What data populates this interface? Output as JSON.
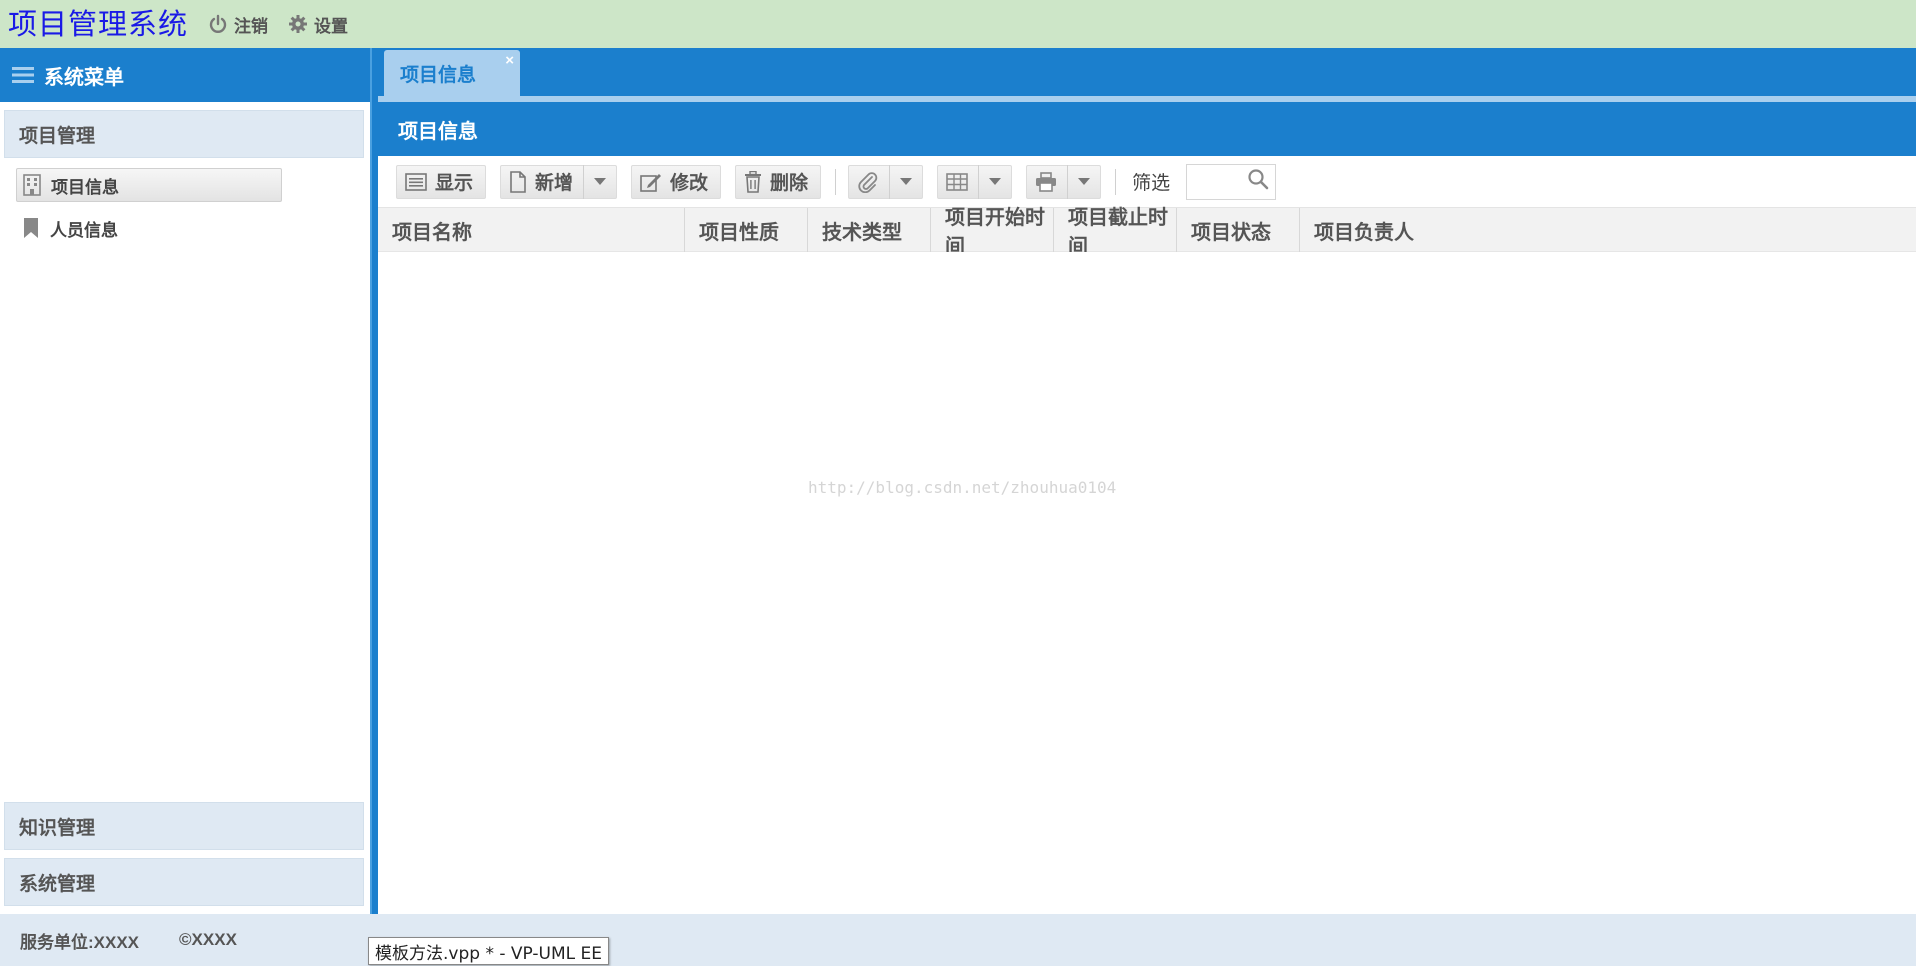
{
  "header": {
    "title": "项目管理系统",
    "logout_label": "注销",
    "settings_label": "设置",
    "bg_color": "#cde6c8",
    "title_color": "#1a1ae6"
  },
  "sidebar": {
    "title": "系统菜单",
    "sections": [
      {
        "label": "项目管理",
        "expanded": true
      },
      {
        "label": "知识管理",
        "expanded": false
      },
      {
        "label": "系统管理",
        "expanded": false
      }
    ],
    "items": [
      {
        "label": "项目信息",
        "icon": "building-icon",
        "active": true
      },
      {
        "label": "人员信息",
        "icon": "bookmark-icon",
        "active": false
      }
    ]
  },
  "tabs": [
    {
      "label": "项目信息",
      "closable": true
    }
  ],
  "panel": {
    "title": "项目信息",
    "accent_color": "#1b7fcd"
  },
  "toolbar": {
    "show_label": "显示",
    "add_label": "新增",
    "edit_label": "修改",
    "delete_label": "删除",
    "filter_label": "筛选",
    "search_placeholder": ""
  },
  "table": {
    "columns": [
      "项目名称",
      "项目性质",
      "技术类型",
      "项目开始时间",
      "项目截止时间",
      "项目状态",
      "项目负责人"
    ],
    "rows": []
  },
  "watermark": "http://blog.csdn.net/zhouhua0104",
  "footer": {
    "service_unit": "服务单位:XXXX",
    "copyright": "©XXXX"
  },
  "tooltip": "模板方法.vpp * - VP-UML EE"
}
